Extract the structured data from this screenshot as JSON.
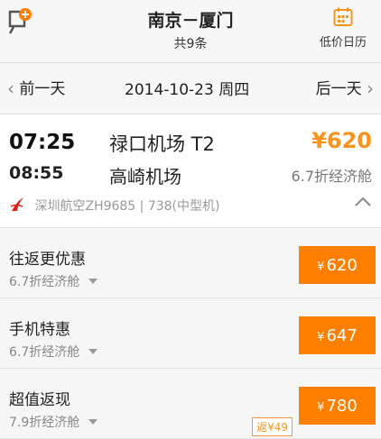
{
  "header": {
    "title": "南京－厦门",
    "subtitle": "共9条",
    "calendar_label": "低价日历"
  },
  "datebar": {
    "prev_label": "前一天",
    "date": "2014-10-23 周四",
    "next_label": "后一天"
  },
  "flight": {
    "dep_time": "07:25",
    "arr_time": "08:55",
    "dep_airport": "禄口机场 T2",
    "arr_airport": "高崎机场",
    "price": "¥620",
    "cabin": "6.7折经济舱",
    "airline_info": "深圳航空ZH9685 | 738(中型机)"
  },
  "fares": [
    {
      "name": "往返更优惠",
      "cabin": "6.7折经济舱",
      "currency": "¥",
      "price": "620"
    },
    {
      "name": "手机特惠",
      "cabin": "6.7折经济舱",
      "currency": "¥",
      "price": "647"
    },
    {
      "name": "超值返现",
      "cabin": "7.9折经济舱",
      "currency": "¥",
      "price": "780",
      "badge": "返¥49"
    }
  ],
  "colors": {
    "accent": "#ff7f00",
    "price": "#f7941d",
    "background": "#f7f7f7"
  }
}
